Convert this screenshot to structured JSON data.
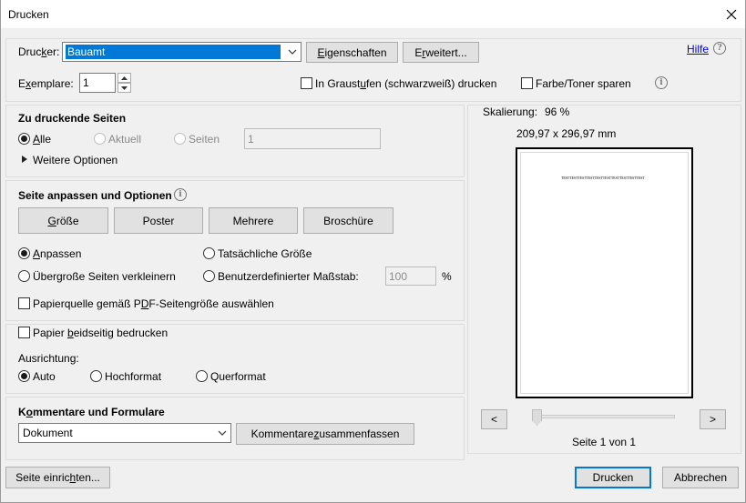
{
  "window": {
    "title": "Drucken"
  },
  "printer": {
    "label_pre": "Druc",
    "label_u": "k",
    "label_post": "er:",
    "selected": "Bauamt",
    "properties_pre": "",
    "properties_u": "E",
    "properties_post": "igenschaften",
    "advanced_pre": "E",
    "advanced_u": "r",
    "advanced_post": "weitert...",
    "help": "Hilfe"
  },
  "copies": {
    "label_pre": "E",
    "label_u": "x",
    "label_post": "emplare:",
    "value": "1",
    "grayscale_pre": "In Graust",
    "grayscale_u": "u",
    "grayscale_post": "fen (schwarzweiß) drucken",
    "save_toner": "Farbe/Toner sparen"
  },
  "pages": {
    "heading": "Zu druckende Seiten",
    "all_u": "A",
    "all_post": "lle",
    "current": "Aktuell",
    "pages": "Seiten",
    "pages_value": "1",
    "more_options": "Weitere Optionen"
  },
  "fit": {
    "heading": "Seite anpassen und Optionen",
    "size_pre": "",
    "size_u": "G",
    "size_post": "röße",
    "poster": "Poster",
    "multiple": "Mehrere",
    "booklet": "Broschüre",
    "fit_u": "A",
    "fit_post": "npassen",
    "actual_size": "Tatsächliche Größe",
    "shrink": "Übergroße Seiten verkleinern",
    "custom_scale": "Benutzerdefinierter Maßstab:",
    "scale_value": "100",
    "percent": "%",
    "paper_source_pre": "Papierquelle gemäß P",
    "paper_source_u": "D",
    "paper_source_post": "F-Seitengröße auswählen"
  },
  "duplex": {
    "label_pre": "Papier ",
    "label_u": "b",
    "label_post": "eidseitig bedrucken",
    "orientation": "Ausrichtung:",
    "auto": "Auto",
    "portrait": "Hochformat",
    "landscape": "Querformat"
  },
  "comments": {
    "heading_pre": "K",
    "heading_u": "o",
    "heading_post": "mmentare und Formulare",
    "selected": "Dokument",
    "summarize_pre": "Kommentare ",
    "summarize_u": "z",
    "summarize_post": "usammenfassen"
  },
  "preview": {
    "scaling_label": "Skalierung:",
    "scaling_value": "96 %",
    "dimensions": "209,97 x 296,97 mm",
    "page_text": "TESTTESTTESTTESTTESTTESTTESTTESTTESTTEST",
    "prev": "<",
    "next": ">",
    "page_status": "Seite 1 von 1"
  },
  "footer": {
    "page_setup_pre": "Seite einric",
    "page_setup_u": "h",
    "page_setup_post": "ten...",
    "print": "Drucken",
    "cancel": "Abbrechen"
  },
  "colors": {
    "selection": "#0078d7",
    "default_button_border": "#0078d7"
  }
}
